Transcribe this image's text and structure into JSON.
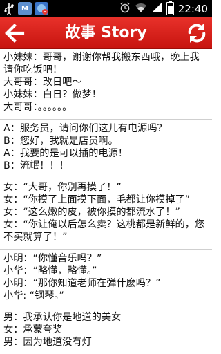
{
  "status_bar": {
    "time": "22:40",
    "app_icon_text": "M",
    "battery_level": 0.8,
    "icons": [
      "usb-icon",
      "app-notification-icon",
      "app-notification-icon",
      "alarm-icon",
      "wifi-icon",
      "signal-icon",
      "battery-icon"
    ]
  },
  "header": {
    "title": "故事 Story",
    "back_icon": "arrow-left-icon",
    "refresh_icon": "refresh-icon",
    "accent_color": "#d91f19"
  },
  "jokes": [
    {
      "lines": [
        "小妹妹：哥哥，谢谢你帮我搬东西哦，晚上我请你吃饭吧！",
        "大哥哥：改日吧～",
        "小妹妹：白日？做梦！",
        "大哥哥：。。。。。。"
      ]
    },
    {
      "lines": [
        "A：服务员，请问你们这儿有电源吗？",
        "B：您好，我就是店员啊。",
        "A：我要的是可以插的电源！",
        "B：流氓！！！"
      ]
    },
    {
      "lines": [
        "女：“大哥，你别再摸了！”",
        "女：“你摸了上面摸下面，毛都让你摸掉了”",
        "女：“这么嫩的皮，被你摸的都流水了！”",
        "女：“你让俺以后怎么卖？这桃都是新鲜的，您不买就算了！”"
      ]
    },
    {
      "lines": [
        "小明：“你懂音乐吗？”",
        "小华：“略懂，略懂。”",
        "小明：“那你知道老师在弹什麽吗？”",
        "小华: “钢琴。”"
      ]
    },
    {
      "lines": [
        "男：我承认你是地道的美女",
        "女：承蒙夸奖",
        "男：因为地道没有灯"
      ]
    }
  ]
}
